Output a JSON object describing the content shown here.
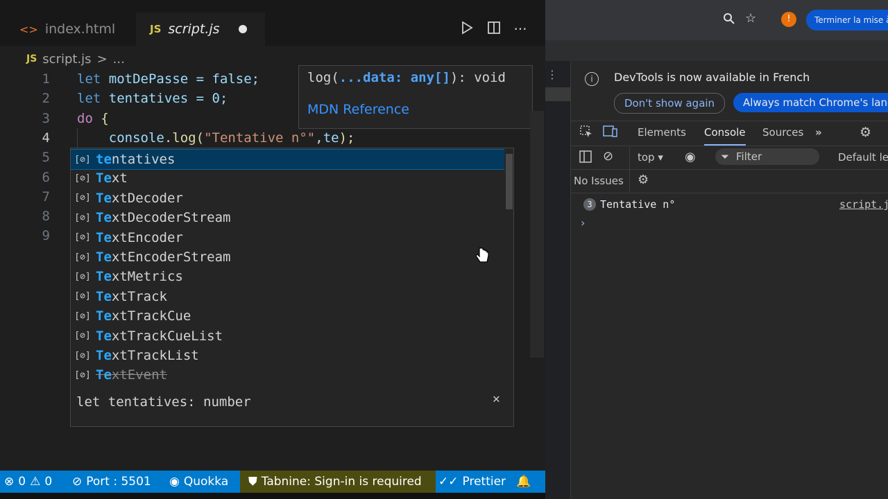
{
  "editor": {
    "tabs": [
      {
        "name": "index.html",
        "icon": "html-file-icon"
      },
      {
        "name": "script.js",
        "icon": "js-file-icon",
        "badge": "JS"
      }
    ],
    "breadcrumb": {
      "file": "script.js",
      "sep": ">",
      "rest": "..."
    },
    "line_numbers": [
      "1",
      "2",
      "3",
      "4",
      "5",
      "6",
      "7",
      "8",
      "9"
    ],
    "code": {
      "l1": {
        "kw": "let",
        "rest": " motDePasse = false;"
      },
      "l2": {
        "kw": "let",
        "rest": " tentatives = 0;"
      },
      "l3": {
        "kw": "do",
        "rest": " {"
      },
      "l4": {
        "indent": "    ",
        "obj": "console",
        "dot": ".",
        "fn": "log",
        "open": "(",
        "str": "\"Tentative n°\"",
        "comma": ",",
        "typed": "te",
        "close": ");"
      }
    },
    "signature_hint": {
      "pre": "log(",
      "param": "...data: any[]",
      "post": "): void",
      "link": "MDN Reference"
    },
    "suggestions": [
      {
        "match": "te",
        "rest": "ntatives",
        "selected": true,
        "deprecated": false
      },
      {
        "match": "Te",
        "rest": "xt",
        "selected": false,
        "deprecated": false
      },
      {
        "match": "Te",
        "rest": "xtDecoder",
        "selected": false,
        "deprecated": false
      },
      {
        "match": "Te",
        "rest": "xtDecoderStream",
        "selected": false,
        "deprecated": false
      },
      {
        "match": "Te",
        "rest": "xtEncoder",
        "selected": false,
        "deprecated": false
      },
      {
        "match": "Te",
        "rest": "xtEncoderStream",
        "selected": false,
        "deprecated": false
      },
      {
        "match": "Te",
        "rest": "xtMetrics",
        "selected": false,
        "deprecated": false
      },
      {
        "match": "Te",
        "rest": "xtTrack",
        "selected": false,
        "deprecated": false
      },
      {
        "match": "Te",
        "rest": "xtTrackCue",
        "selected": false,
        "deprecated": false
      },
      {
        "match": "Te",
        "rest": "xtTrackCueList",
        "selected": false,
        "deprecated": false
      },
      {
        "match": "Te",
        "rest": "xtTrackList",
        "selected": false,
        "deprecated": false
      },
      {
        "match": "Te",
        "rest": "xtEvent",
        "selected": false,
        "deprecated": true
      }
    ],
    "suggestion_icon": "[⊘]",
    "detail": "let tentatives: number",
    "statusbar": {
      "errors": "0",
      "warnings": "0",
      "port": "Port : 5501",
      "quokka": "Quokka",
      "tabnine": "Tabnine: Sign-in is required",
      "prettier": "Prettier"
    }
  },
  "browser": {
    "update_button": "Terminer la mise à",
    "devtools": {
      "info_message": "DevTools is now available in French",
      "dont_show": "Don't show again",
      "always_match": "Always match Chrome's lang",
      "tabs": [
        "Elements",
        "Console",
        "Sources"
      ],
      "active_tab": "Console",
      "context": "top ▾",
      "filter_placeholder": "Filter",
      "levels": "Default lev",
      "issues": "No Issues",
      "log": {
        "count": "3",
        "message": "Tentative n°",
        "source": "script.js"
      },
      "prompt": "›"
    }
  },
  "colors": {
    "statusbar": "#007acc",
    "selection": "#04395e",
    "accent": "#8ab4f8"
  }
}
